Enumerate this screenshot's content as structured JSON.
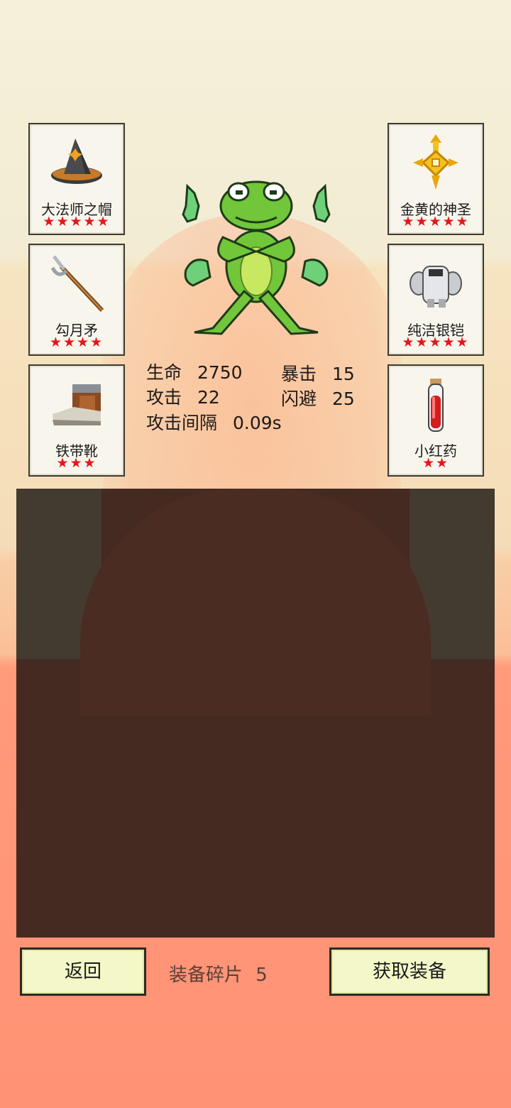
{
  "equipment_left": [
    {
      "name": "大法师之帽",
      "stars": "★★★★★",
      "icon": "wizard-hat-icon"
    },
    {
      "name": "勾月矛",
      "stars": "★★★★",
      "icon": "crescent-spear-icon"
    },
    {
      "name": "铁带靴",
      "stars": "★★★",
      "icon": "iron-boots-icon"
    }
  ],
  "equipment_right": [
    {
      "name": "金黄的神圣",
      "stars": "★★★★★",
      "icon": "golden-holy-cross-icon"
    },
    {
      "name": "纯洁银铠",
      "stars": "★★★★★",
      "icon": "silver-armor-icon"
    },
    {
      "name": "小红药",
      "stars": "★★",
      "icon": "red-potion-icon"
    }
  ],
  "stats": {
    "hp_label": "生命",
    "hp_value": "2750",
    "crit_label": "暴击",
    "crit_value": "15",
    "atk_label": "攻击",
    "atk_value": "22",
    "dodge_label": "闪避",
    "dodge_value": "25",
    "interval_label": "攻击间隔",
    "interval_value": "0.09s"
  },
  "footer": {
    "back_label": "返回",
    "shards_label": "装备碎片",
    "shards_value": "5",
    "get_label": "获取装备"
  },
  "colors": {
    "star": "#e5161c",
    "frog": "#6fcf3a",
    "button_bg": "#f4f8c8"
  }
}
